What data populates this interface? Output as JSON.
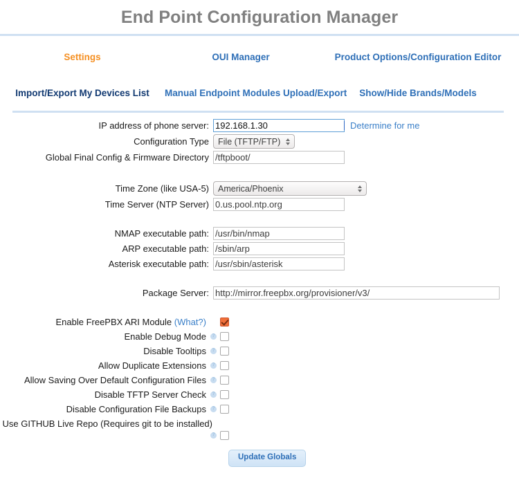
{
  "page": {
    "title": "End Point Configuration Manager"
  },
  "nav": {
    "row1": [
      {
        "label": "Settings",
        "state": "active"
      },
      {
        "label": "OUI Manager",
        "state": "link"
      },
      {
        "label": "Product Options/Configuration Editor",
        "state": "link"
      }
    ],
    "row2": [
      {
        "label": "Import/Export My Devices List",
        "state": "strong"
      },
      {
        "label": "Manual Endpoint Modules Upload/Export",
        "state": "link"
      },
      {
        "label": "Show/Hide Brands/Models",
        "state": "link"
      }
    ]
  },
  "form": {
    "ip_address": {
      "label": "IP address of phone server:",
      "value": "192.168.1.30",
      "link": "Determine for me"
    },
    "config_type": {
      "label": "Configuration Type",
      "value": "File (TFTP/FTP)"
    },
    "global_dir": {
      "label": "Global Final Config & Firmware Directory",
      "value": "/tftpboot/"
    },
    "time_zone": {
      "label": "Time Zone (like USA-5)",
      "value": "America/Phoenix"
    },
    "time_server": {
      "label": "Time Server (NTP Server)",
      "value": "0.us.pool.ntp.org"
    },
    "nmap_path": {
      "label": "NMAP executable path:",
      "value": "/usr/bin/nmap"
    },
    "arp_path": {
      "label": "ARP executable path:",
      "value": "/sbin/arp"
    },
    "asterisk_path": {
      "label": "Asterisk executable path:",
      "value": "/usr/sbin/asterisk"
    },
    "package_server": {
      "label": "Package Server:",
      "value": "http://mirror.freepbx.org/provisioner/v3/"
    }
  },
  "checkboxes": [
    {
      "label": "Enable FreePBX ARI Module",
      "help_link": "(What?)",
      "checked": true,
      "info_icon": false
    },
    {
      "label": "Enable Debug Mode",
      "checked": false,
      "info_icon": true
    },
    {
      "label": "Disable Tooltips",
      "checked": false,
      "info_icon": true
    },
    {
      "label": "Allow Duplicate Extensions",
      "checked": false,
      "info_icon": true
    },
    {
      "label": "Allow Saving Over Default Configuration Files",
      "checked": false,
      "info_icon": true
    },
    {
      "label": "Disable TFTP Server Check",
      "checked": false,
      "info_icon": true
    },
    {
      "label": "Disable Configuration File Backups",
      "checked": false,
      "info_icon": true
    }
  ],
  "last_checkbox": {
    "label": "Use GITHUB Live Repo (Requires git to be installed)",
    "checked": false
  },
  "submit": {
    "label": "Update Globals"
  },
  "colors": {
    "title": "#808080",
    "link": "#2e6fb7",
    "active": "#f59023",
    "strong": "#123a72",
    "rule": "#cfe0f2",
    "checked_box": "#f0703a",
    "focus_border": "#5e9fd6",
    "button_text": "#2e6fb7"
  }
}
